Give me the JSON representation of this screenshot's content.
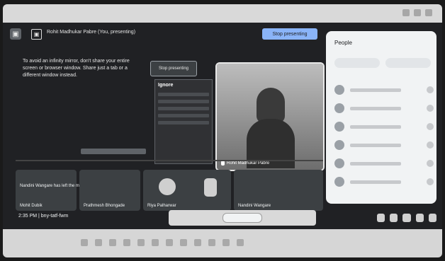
{
  "meet": {
    "presenter_label": "Rohit Madhukar Pabre (You, presenting)",
    "stop_presenting_label": "Stop presenting",
    "warning_text": "To avoid an infinity mirror, don't share your entire screen or browser window. Share just a tab or a different window instead.",
    "stop_button_label": "Stop presenting",
    "mirror_title": "Ignore",
    "self_tile_name": "Rohit Madhukar Pabre",
    "thumb_notice": "Nandini Wangare has left the meeting",
    "thumb_label_1": "Mohit Dubik",
    "thumb_label_2": "Prathmesh Bhongade",
    "thumb_label_3": "Riya Palharwar",
    "thumb_label_4": "Nandini Wangare",
    "time": "2:35 PM | bny-tatf-fwm",
    "controls_label": "",
    "people_title": "People"
  }
}
